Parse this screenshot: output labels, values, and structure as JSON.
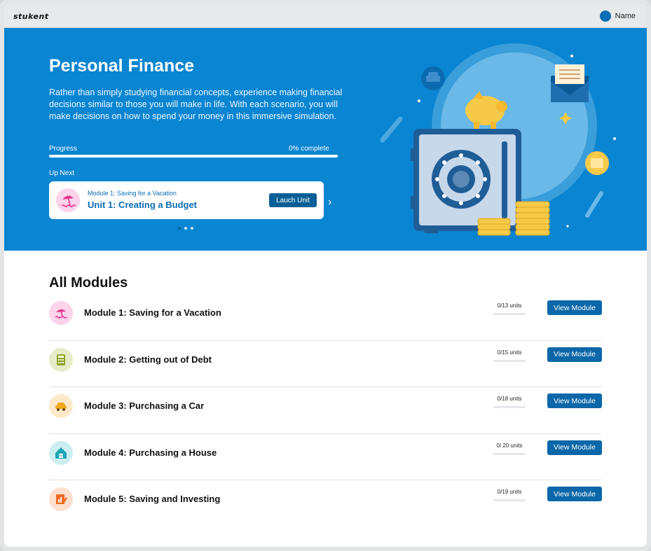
{
  "app": {
    "logo": "stukent",
    "user_name": "Name"
  },
  "hero": {
    "title": "Personal Finance",
    "description": "Rather than simply studying financial concepts, experience making financial decisions similar to those you will make in life. With each scenario, you will make decisions on how to spend your money in this immersive simulation.",
    "progress_label": "Progress",
    "progress_text": "0% complete",
    "progress_value": 0,
    "up_next_label": "Up Next",
    "up_next": {
      "module": "Module 1: Saving for a Vacation",
      "unit": "Unit 1: Creating a Budget",
      "button": "Lauch Unit"
    },
    "carousel": {
      "count": 3,
      "active": 0
    }
  },
  "modules_section": {
    "title": "All Modules",
    "modules": [
      {
        "name": "Module 1: Saving for a Vacation",
        "units": "0/13 units",
        "progress": 0,
        "button": "View Module",
        "icon": "beach-umbrella-icon",
        "icon_bg": "#fbd3ea",
        "icon_color": "#e8338e"
      },
      {
        "name": "Module 2: Getting out of Debt",
        "units": "0/15 units",
        "progress": 0,
        "button": "View Module",
        "icon": "calculator-icon",
        "icon_bg": "#e6ecc7",
        "icon_color": "#8ea11e"
      },
      {
        "name": "Module 3: Purchasing a Car",
        "units": "0/18 units",
        "progress": 0,
        "button": "View Module",
        "icon": "car-icon",
        "icon_bg": "#fde9c8",
        "icon_color": "#f0a81d"
      },
      {
        "name": "Module 4: Purchasing a House",
        "units": "0/ 20 units",
        "progress": 0,
        "button": "View Module",
        "icon": "house-icon",
        "icon_bg": "#cdeef1",
        "icon_color": "#19a5b5"
      },
      {
        "name": "Module 5: Saving and Investing",
        "units": "0/19 units",
        "progress": 0,
        "button": "View Module",
        "icon": "investment-chart-icon",
        "icon_bg": "#fde0cf",
        "icon_color": "#f06b21"
      }
    ]
  },
  "colors": {
    "hero_bg": "#0a85d1",
    "primary_button": "#0b67a8",
    "accent_text": "#0a6cb3"
  }
}
